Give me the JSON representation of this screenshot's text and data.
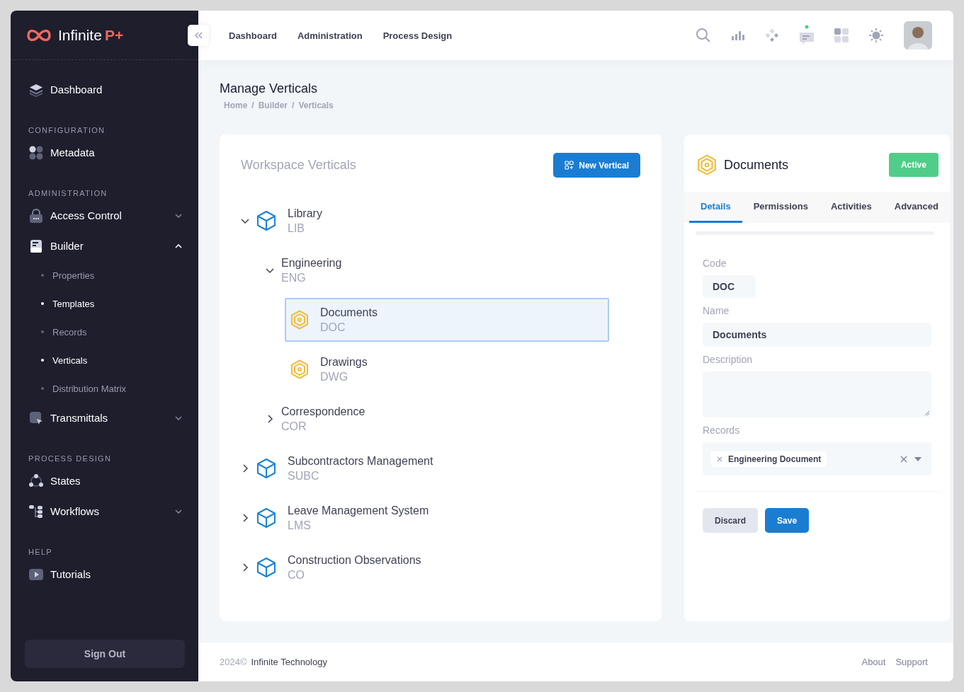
{
  "brand": {
    "name": "Infinite",
    "suffix": "P+"
  },
  "sidebar": [
    {
      "items": [
        {
          "label": "Dashboard"
        }
      ]
    },
    {
      "heading": "CONFIGURATION",
      "items": [
        {
          "label": "Metadata"
        }
      ]
    },
    {
      "heading": "ADMINISTRATION",
      "items": [
        {
          "label": "Access Control",
          "expanded": false
        },
        {
          "label": "Builder",
          "expanded": true,
          "children": [
            {
              "label": "Properties",
              "active": false
            },
            {
              "label": "Templates",
              "active": true
            },
            {
              "label": "Records",
              "active": false
            },
            {
              "label": "Verticals",
              "active": true
            },
            {
              "label": "Distribution Matrix",
              "active": false
            }
          ]
        },
        {
          "label": "Transmittals",
          "expanded": false
        }
      ]
    },
    {
      "heading": "PROCESS DESIGN",
      "items": [
        {
          "label": "States"
        },
        {
          "label": "Workflows",
          "expanded": false
        }
      ]
    },
    {
      "heading": "HELP",
      "items": [
        {
          "label": "Tutorials"
        }
      ]
    }
  ],
  "sign_out": "Sign Out",
  "top_nav": [
    "Dashboard",
    "Administration",
    "Process Design"
  ],
  "page": {
    "title": "Manage Verticals",
    "breadcrumb": [
      "Home",
      "Builder",
      "Verticals"
    ],
    "breadcrumb_separator": "/"
  },
  "tree_card": {
    "title": "Workspace Verticals",
    "button": "New Vertical",
    "tree": [
      {
        "kind": "cube",
        "name": "Library",
        "code": "LIB",
        "expanded": true,
        "selected": false,
        "children": [
          {
            "name": "Engineering",
            "code": "ENG",
            "expanded": true,
            "selected": false,
            "children": [
              {
                "kind": "hex",
                "name": "Documents",
                "code": "DOC",
                "selected": true
              },
              {
                "kind": "hex",
                "name": "Drawings",
                "code": "DWG",
                "selected": false
              }
            ]
          },
          {
            "name": "Correspondence",
            "code": "COR",
            "expanded": false,
            "selected": false
          }
        ]
      },
      {
        "kind": "cube",
        "name": "Subcontractors Management",
        "code": "SUBC",
        "expanded": false,
        "selected": false
      },
      {
        "kind": "cube",
        "name": "Leave Management System",
        "code": "LMS",
        "expanded": false,
        "selected": false
      },
      {
        "kind": "cube",
        "name": "Construction Observations",
        "code": "CO",
        "expanded": false,
        "selected": false
      }
    ]
  },
  "detail": {
    "title": "Documents",
    "status": "Active",
    "tabs": [
      {
        "label": "Details",
        "selected": true
      },
      {
        "label": "Permissions",
        "selected": false
      },
      {
        "label": "Activities",
        "selected": false
      },
      {
        "label": "Advanced",
        "selected": false
      }
    ],
    "code": {
      "label": "Code",
      "value": "DOC"
    },
    "name": {
      "label": "Name",
      "value": "Documents"
    },
    "description": {
      "label": "Description"
    },
    "records": {
      "label": "Records",
      "tags": [
        "Engineering Document"
      ]
    },
    "buttons": {
      "discard": "Discard",
      "save": "Save"
    }
  },
  "footer": {
    "year": "2024©",
    "company": "Infinite Technology",
    "links": [
      "About",
      "Support"
    ]
  }
}
